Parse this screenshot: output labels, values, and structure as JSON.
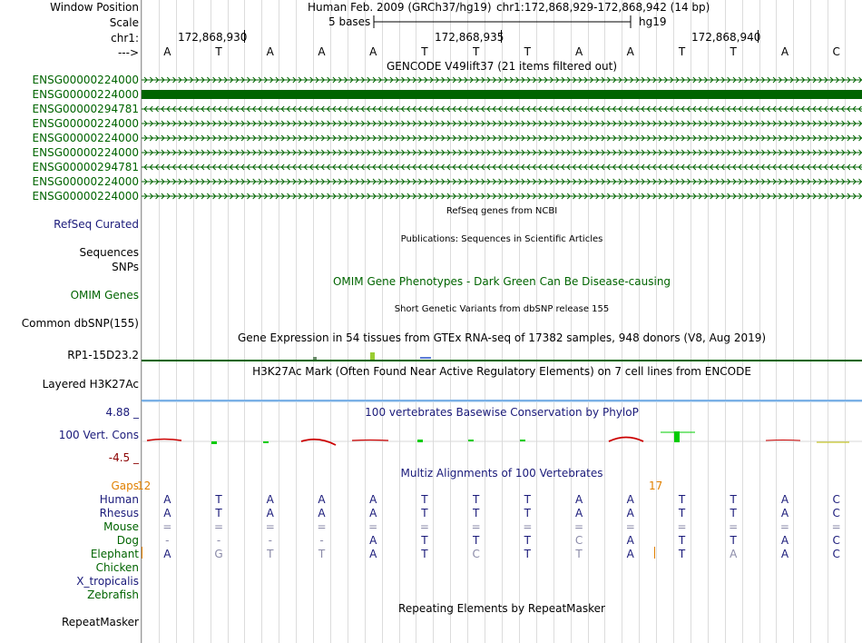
{
  "labels": {
    "window_position": "Window Position",
    "scale": "Scale",
    "chr": "chr1:",
    "arrow": "--->",
    "refseq": "RefSeq Curated",
    "sequences": "Sequences",
    "snps": "SNPs",
    "omim": "OMIM Genes",
    "dbsnp": "Common dbSNP(155)",
    "gtex_gene": "RP1-15D23.2",
    "h3k27ac": "Layered H3K27Ac",
    "phylop_max": "4.88 _",
    "vert_cons": "100 Vert. Cons",
    "phylop_min": "-4.5 _",
    "gaps": "Gaps",
    "gaps_num": "12",
    "repeatmasker": "RepeatMasker"
  },
  "header": {
    "assembly": "Human Feb. 2009 (GRCh37/hg19)",
    "position": "chr1:172,868,929-172,868,942 (14 bp)",
    "scale_text": "5 bases",
    "db": "hg19",
    "coord1": "172,868,930",
    "coord2": "172,868,935",
    "coord3": "172,868,940"
  },
  "sequence": [
    "A",
    "T",
    "A",
    "A",
    "A",
    "T",
    "T",
    "T",
    "A",
    "A",
    "T",
    "T",
    "A",
    "C"
  ],
  "tracks": {
    "gencode_title": "GENCODE V49lift37 (21 items filtered out)",
    "refseq_title": "RefSeq genes from NCBI",
    "pubs_title": "Publications: Sequences in Scientific Articles",
    "omim_title": "OMIM Gene Phenotypes - Dark Green Can Be Disease-causing",
    "dbsnp_title": "Short Genetic Variants from dbSNP release 155",
    "gtex_title": "Gene Expression in 54 tissues from GTEx RNA-seq of 17382 samples, 948 donors (V8, Aug 2019)",
    "h3k27ac_title": "H3K27Ac Mark (Often Found Near Active Regulatory Elements) on 7 cell lines from ENCODE",
    "phylop_title": "100 vertebrates Basewise Conservation by PhyloP",
    "multiz_title": "Multiz Alignments of 100 Vertebrates",
    "repeat_title": "Repeating Elements by RepeatMasker",
    "gap_right": "17"
  },
  "genes": [
    {
      "id": "ENSG00000224000",
      "strand": "+"
    },
    {
      "id": "ENSG00000224000",
      "strand": "solid"
    },
    {
      "id": "ENSG00000294781",
      "strand": "-"
    },
    {
      "id": "ENSG00000224000",
      "strand": "+"
    },
    {
      "id": "ENSG00000224000",
      "strand": "+"
    },
    {
      "id": "ENSG00000224000",
      "strand": "+"
    },
    {
      "id": "ENSG00000294781",
      "strand": "-"
    },
    {
      "id": "ENSG00000224000",
      "strand": "+"
    },
    {
      "id": "ENSG00000224000",
      "strand": "+"
    }
  ],
  "species": [
    {
      "name": "Human",
      "bases": [
        "A",
        "T",
        "A",
        "A",
        "A",
        "T",
        "T",
        "T",
        "A",
        "A",
        "T",
        "T",
        "A",
        "C"
      ],
      "faint": []
    },
    {
      "name": "Rhesus",
      "bases": [
        "A",
        "T",
        "A",
        "A",
        "A",
        "T",
        "T",
        "T",
        "A",
        "A",
        "T",
        "T",
        "A",
        "C"
      ],
      "faint": []
    },
    {
      "name": "Mouse",
      "bases": [
        "=",
        "=",
        "=",
        "=",
        "=",
        "=",
        "=",
        "=",
        "=",
        "=",
        "=",
        "=",
        "=",
        "="
      ],
      "faint": [
        0,
        1,
        2,
        3,
        4,
        5,
        6,
        7,
        8,
        9,
        10,
        11,
        12,
        13
      ]
    },
    {
      "name": "Dog",
      "bases": [
        "-",
        "-",
        "-",
        "-",
        "A",
        "T",
        "T",
        "T",
        "C",
        "A",
        "T",
        "T",
        "A",
        "C"
      ],
      "faint": [
        0,
        1,
        2,
        3,
        8
      ]
    },
    {
      "name": "Elephant",
      "bases": [
        "A",
        "G",
        "T",
        "T",
        "A",
        "T",
        "C",
        "T",
        "T",
        "A",
        "T",
        "A",
        "A",
        "C"
      ],
      "faint": [
        1,
        2,
        3,
        6,
        8,
        11
      ]
    },
    {
      "name": "Chicken",
      "bases": [],
      "faint": []
    },
    {
      "name": "X_tropicalis",
      "bases": [],
      "faint": []
    },
    {
      "name": "Zebrafish",
      "bases": [],
      "faint": []
    }
  ],
  "colors": {
    "gene_green": "#006400",
    "navy": "#1a1a7a",
    "phylop_pos": "#00cc00",
    "phylop_neg": "#cc0000",
    "gaps_orange": "#e08000"
  }
}
